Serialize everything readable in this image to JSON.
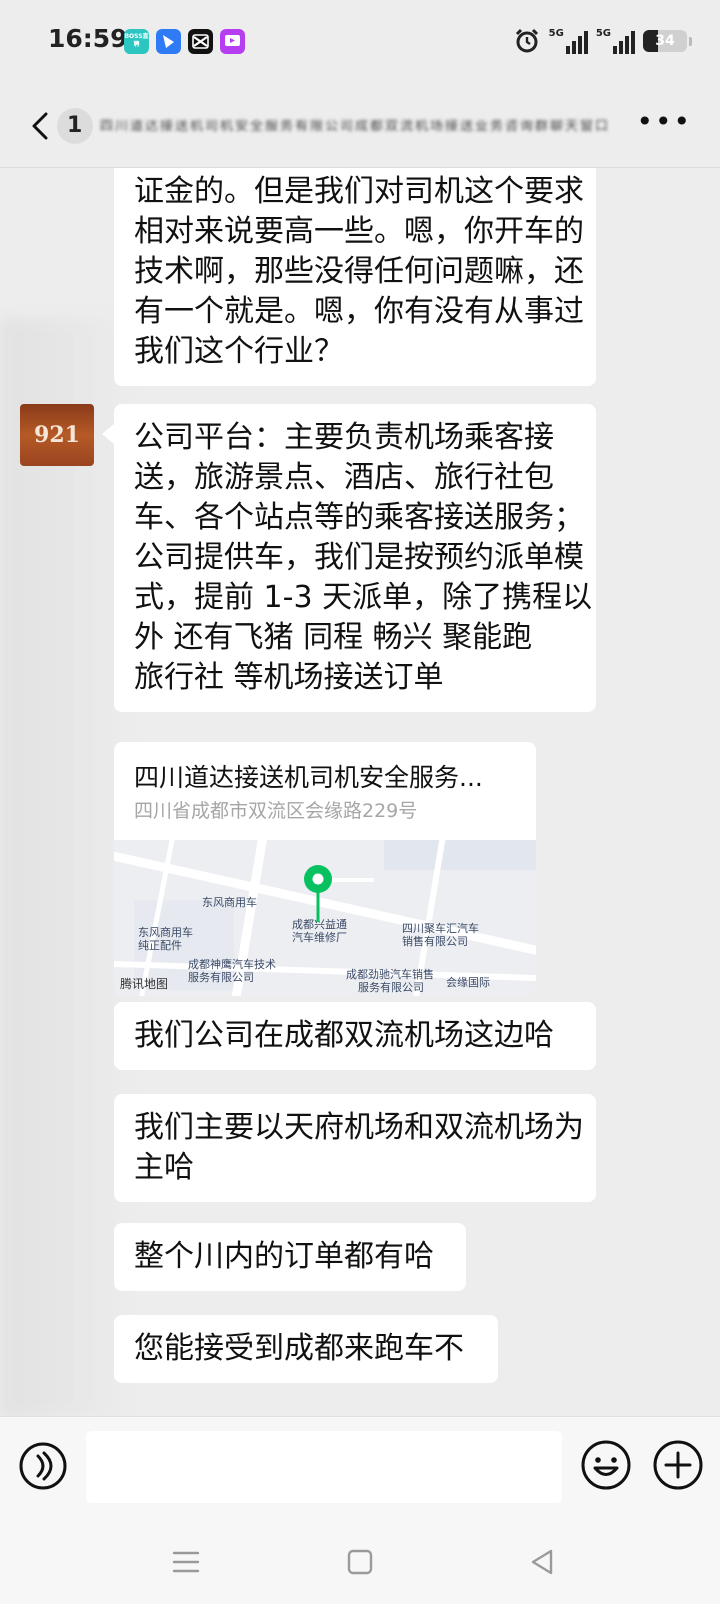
{
  "status_bar": {
    "time": "16:59",
    "app_icons": [
      {
        "name": "boss-icon",
        "label": "BOSS直聘",
        "color": "#2cc6c1"
      },
      {
        "name": "feishu-icon",
        "label": "",
        "color": "#2f7bf5"
      },
      {
        "name": "capcut-icon",
        "label": "",
        "color": "#111111"
      },
      {
        "name": "video-app-icon",
        "label": "",
        "color": "#b53ef0"
      }
    ],
    "network_1": "5G",
    "network_2": "5G",
    "battery_level": 34,
    "battery_text": "34"
  },
  "header": {
    "unread_count": "1",
    "title": "四川道达接送机司机安全服务有限公司成都双流机场接送业务咨询群聊天窗口"
  },
  "messages": [
    {
      "type": "text",
      "lines": [
        "证金的。但是我们对司机这个要求",
        "相对来说要高一些。嗯，你开车的",
        "技术啊，那些没得任何问题嘛，还",
        "有一个就是。嗯，你有没有从事过",
        "我们这个行业？"
      ]
    },
    {
      "type": "text",
      "lines": [
        "公司平台：主要负责机场乘客接",
        "送，旅游景点、酒店、旅行社包",
        "车、各个站点等的乘客接送服务；",
        "公司提供车，我们是按预约派单模",
        "式，提前 1-3 天派单，除了携程以",
        "外 还有飞猪  同程  畅兴  聚能跑",
        "旅行社  等机场接送订单"
      ]
    },
    {
      "type": "text",
      "lines": [
        "我们公司在成都双流机场这边哈"
      ]
    },
    {
      "type": "text",
      "lines": [
        "我们主要以天府机场和双流机场为",
        "主哈"
      ]
    },
    {
      "type": "text",
      "lines": [
        "整个川内的订单都有哈"
      ]
    },
    {
      "type": "text",
      "lines": [
        "您能接受到成都来跑车不"
      ]
    }
  ],
  "avatar_text": "921",
  "location": {
    "title": "四川道达接送机司机安全服务...",
    "address": "四川省成都市双流区会缘路229号",
    "map_labels": {
      "dongfeng": "东风商用车",
      "dongfeng_parts": [
        "东风商用车",
        "纯正配件"
      ],
      "target": [
        "成都兴益通",
        "汽车维修厂"
      ],
      "sichuan_juche": [
        "四川聚车汇汽车",
        "销售有限公司"
      ],
      "shenying": [
        "成都神鹰汽车技术",
        "服务有限公司"
      ],
      "jinchi": [
        "成都劲驰汽车销售",
        "服务有限公司"
      ],
      "huiyuan": "会缘国际"
    },
    "map_credit": "腾讯地图"
  },
  "input": {
    "value": "",
    "placeholder": ""
  },
  "colors": {
    "background": "#ededed",
    "bubble": "#ffffff",
    "pin": "#07c160"
  }
}
